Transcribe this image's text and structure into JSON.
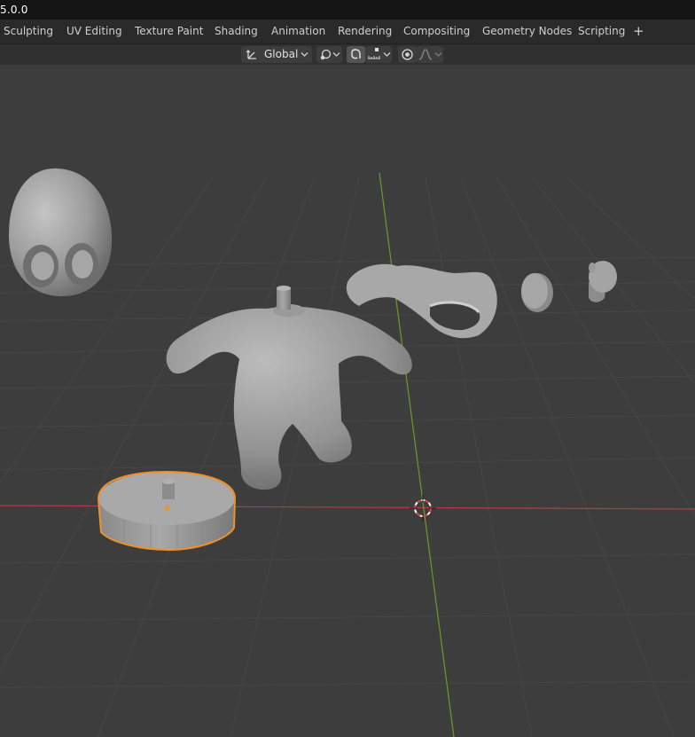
{
  "app": {
    "version_text": "5.0.0"
  },
  "workspace_tabs": [
    "Sculpting",
    "UV Editing",
    "Texture Paint",
    "Shading",
    "Animation",
    "Rendering",
    "Compositing",
    "Geometry Nodes",
    "Scripting"
  ],
  "add_tab_symbol": "+",
  "header": {
    "transform_orientation": "Global"
  },
  "scene": {
    "objects": [
      "head",
      "body",
      "base",
      "cap",
      "button",
      "peg"
    ],
    "selected_object": "base"
  },
  "colors": {
    "viewport_bg": "#3d3d3d",
    "grid_line": "#464646",
    "x_axis": "#b13c4a",
    "y_axis": "#6b9a28",
    "selection_outline": "#f0902a",
    "mesh": "#9a9a9a"
  },
  "icons": [
    "transform-orientation-icon",
    "pivot-link-icon",
    "snap-magnet-icon",
    "snap-increment-icon",
    "proportional-edit-icon",
    "falloff-curve-icon",
    "3d-cursor-icon",
    "origin-dot-icon"
  ]
}
